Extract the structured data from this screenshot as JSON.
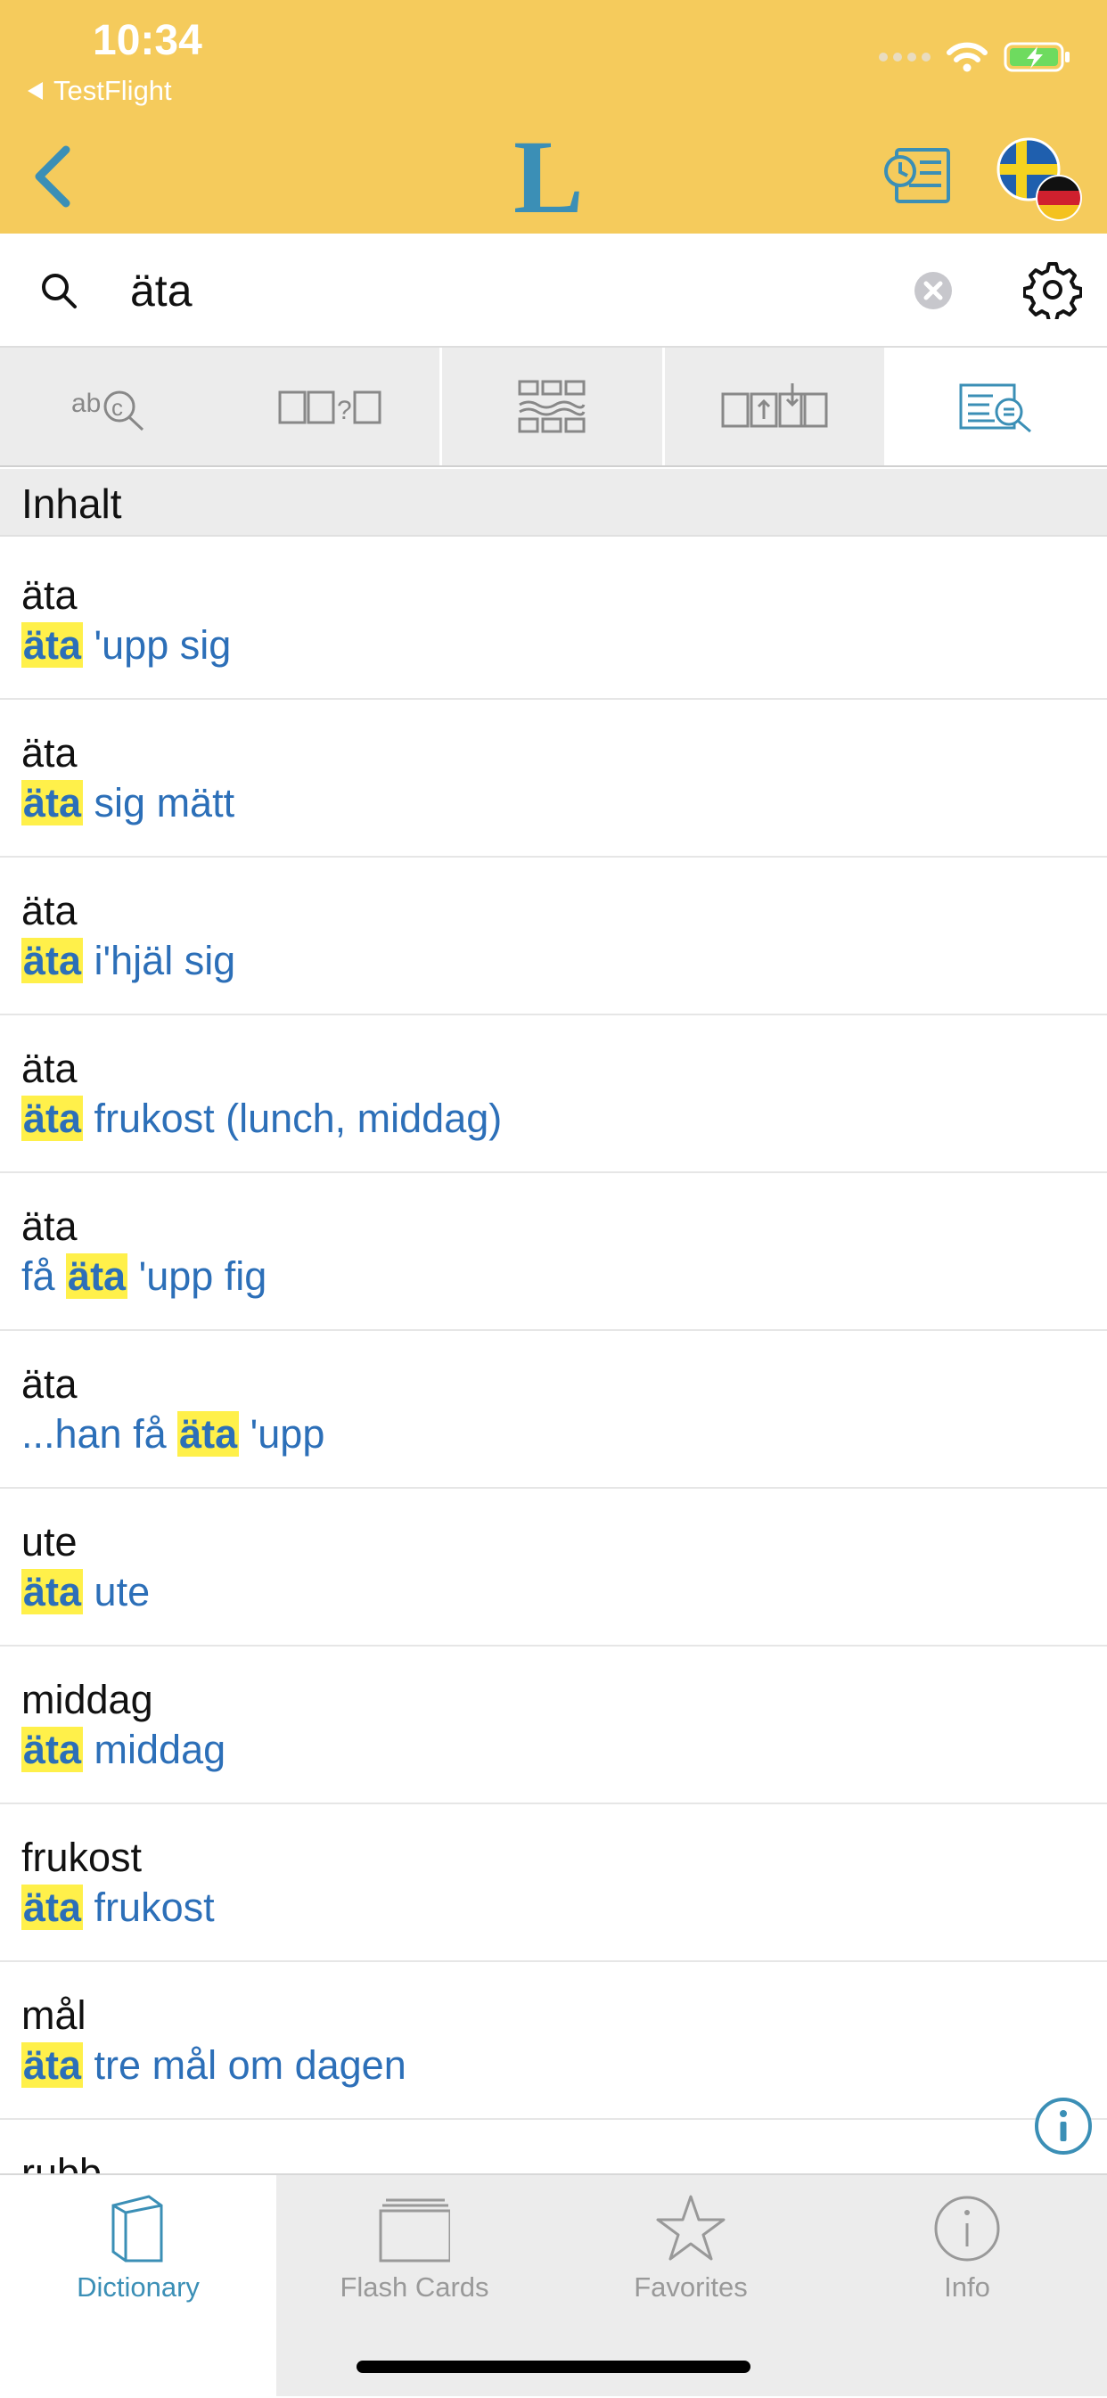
{
  "status_bar": {
    "time": "10:34",
    "back_app_label": "TestFlight",
    "wifi_icon": "wifi-icon",
    "battery_icon": "battery-charging-icon"
  },
  "nav": {
    "back_icon": "chevron-left-icon",
    "logo_letter": "L",
    "history_icon": "history-icon",
    "language_icon": "language-flag-icon"
  },
  "search": {
    "query": "äta",
    "placeholder": ""
  },
  "mode_tabs": [
    {
      "icon": "spellcheck-search-icon",
      "active": false
    },
    {
      "icon": "word-quiz-icon",
      "active": false
    },
    {
      "icon": "grid-compare-icon",
      "active": false
    },
    {
      "icon": "transfer-icon",
      "active": false
    },
    {
      "icon": "fulltext-search-icon",
      "active": true
    }
  ],
  "section": {
    "title": "Inhalt"
  },
  "results": [
    {
      "headword": "äta",
      "before": "",
      "match": "äta",
      "after": " 'upp sig"
    },
    {
      "headword": "äta",
      "before": "",
      "match": "äta",
      "after": " sig mätt"
    },
    {
      "headword": "äta",
      "before": "",
      "match": "äta",
      "after": " i'hjäl sig"
    },
    {
      "headword": "äta",
      "before": "",
      "match": "äta",
      "after": " frukost (lunch, middag)"
    },
    {
      "headword": "äta",
      "before": "få ",
      "match": "äta",
      "after": " 'upp fig"
    },
    {
      "headword": "äta",
      "before": "...han få ",
      "match": "äta",
      "after": " 'upp"
    },
    {
      "headword": "ute",
      "before": "",
      "match": "äta",
      "after": " ute"
    },
    {
      "headword": "middag",
      "before": "",
      "match": "äta",
      "after": " middag"
    },
    {
      "headword": "frukost",
      "before": "",
      "match": "äta",
      "after": " frukost"
    },
    {
      "headword": "mål",
      "before": "",
      "match": "äta",
      "after": " tre mål om dagen"
    },
    {
      "headword": "rubb",
      "before": "",
      "match": "",
      "after": ""
    }
  ],
  "tabbar": [
    {
      "label": "Dictionary",
      "icon": "book-icon",
      "active": true
    },
    {
      "label": "Flash Cards",
      "icon": "flash-cards-icon",
      "active": false
    },
    {
      "label": "Favorites",
      "icon": "star-icon",
      "active": false
    },
    {
      "label": "Info",
      "icon": "info-icon",
      "active": false
    }
  ],
  "colors": {
    "header_bg": "#F5CB5C",
    "accent": "#3B8FB6",
    "link_blue": "#2C6FB8",
    "highlight": "#FFF04A"
  }
}
